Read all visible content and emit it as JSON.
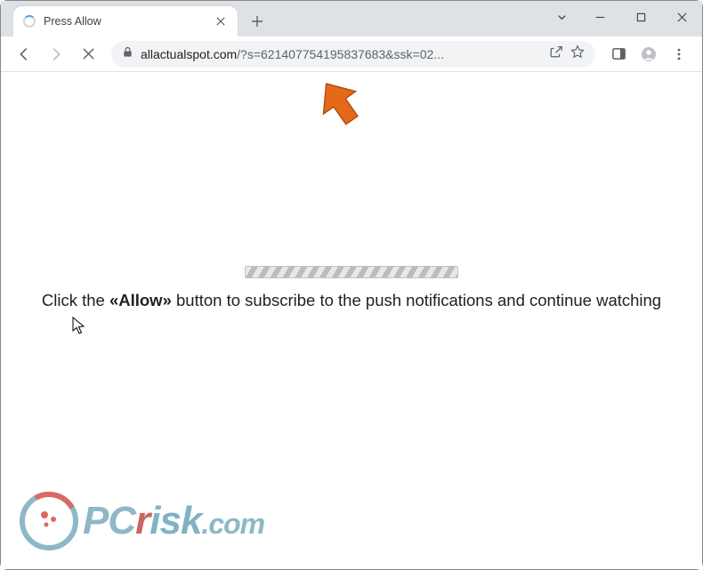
{
  "tab": {
    "title": "Press Allow"
  },
  "address": {
    "host": "allactualspot.com",
    "path": "/?s=621407754195837683&ssk=02..."
  },
  "page": {
    "click_prefix": "Click the ",
    "allow": "«Allow»",
    "click_suffix": " button to subscribe to the push notifications and continue watching"
  },
  "watermark": {
    "pc": "PC",
    "risk": "isk",
    "r": "r",
    "dotcom": ".com"
  }
}
